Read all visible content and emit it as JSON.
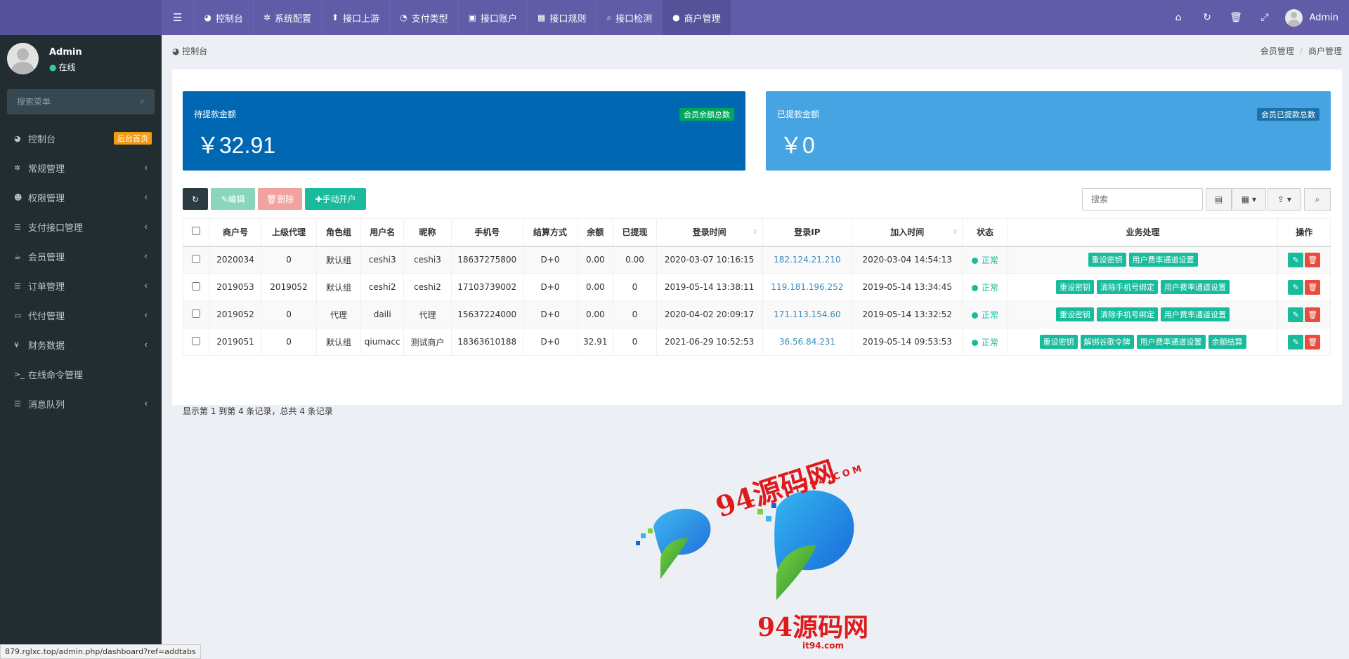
{
  "topnav": {
    "items": [
      {
        "icon": "dashboard-icon",
        "label": "控制台"
      },
      {
        "icon": "gear-icon",
        "label": "系统配置"
      },
      {
        "icon": "upload-icon",
        "label": "接口上游"
      },
      {
        "icon": "pie-icon",
        "label": "支付类型"
      },
      {
        "icon": "account-icon",
        "label": "接口账户"
      },
      {
        "icon": "rules-icon",
        "label": "接口规则"
      },
      {
        "icon": "search-icon",
        "label": "接口检测"
      },
      {
        "icon": "user-icon",
        "label": "商户管理"
      }
    ],
    "active": "商户管理",
    "right_icons": [
      "home-icon",
      "refresh-icon",
      "trash-icon",
      "fullscreen-icon"
    ],
    "user": "Admin"
  },
  "sidebar": {
    "username": "Admin",
    "status": "在线",
    "search_placeholder": "搜索菜单",
    "items": [
      {
        "label": "控制台",
        "badge": "后台首页",
        "icon": "dashboard-icon"
      },
      {
        "label": "常规管理",
        "icon": "cogs-icon"
      },
      {
        "label": "权限管理",
        "icon": "users-icon"
      },
      {
        "label": "支付接口管理",
        "icon": "list-icon"
      },
      {
        "label": "会员管理",
        "icon": "coffee-icon"
      },
      {
        "label": "订单管理",
        "icon": "list-icon"
      },
      {
        "label": "代付管理",
        "icon": "money-icon"
      },
      {
        "label": "财务数据",
        "icon": "yen-icon"
      },
      {
        "label": "在线命令管理",
        "icon": "terminal-icon"
      },
      {
        "label": "消息队列",
        "icon": "list-icon"
      }
    ]
  },
  "breadcrumb": {
    "home": "控制台",
    "path": [
      "会员管理",
      "商户管理"
    ]
  },
  "stats": [
    {
      "label": "待提款金额",
      "value": "￥32.91",
      "tag": "会员余额总数",
      "color": "#0068b3"
    },
    {
      "label": "已提款金额",
      "value": "￥0",
      "tag": "会员已提款总数",
      "color": "#45a4e1"
    }
  ],
  "toolbar": {
    "edit": "编辑",
    "delete": "删除",
    "add": "手动开户",
    "search_placeholder": "搜索"
  },
  "table": {
    "headers": [
      "商户号",
      "上级代理",
      "角色组",
      "用户名",
      "昵称",
      "手机号",
      "结算方式",
      "余额",
      "已提现",
      "登录时间",
      "登录IP",
      "加入时间",
      "状态",
      "业务处理",
      "操作"
    ],
    "rows": [
      {
        "id": "2020034",
        "parent": "0",
        "group": "默认组",
        "username": "ceshi3",
        "nickname": "ceshi3",
        "phone": "18637275800",
        "settle": "D+0",
        "balance": "0.00",
        "withdrawn": "0.00",
        "login_time": "2020-03-07 10:16:15",
        "login_ip": "182.124.21.210",
        "join_time": "2020-03-04 14:54:13",
        "status": "正常",
        "actions": [
          "重设密钥",
          "用户费率通道设置"
        ]
      },
      {
        "id": "2019053",
        "parent": "2019052",
        "group": "默认组",
        "username": "ceshi2",
        "nickname": "ceshi2",
        "phone": "17103739002",
        "settle": "D+0",
        "balance": "0.00",
        "withdrawn": "0",
        "login_time": "2019-05-14 13:38:11",
        "login_ip": "119.181.196.252",
        "join_time": "2019-05-14 13:34:45",
        "status": "正常",
        "actions": [
          "重设密钥",
          "清除手机号绑定",
          "用户费率通道设置"
        ]
      },
      {
        "id": "2019052",
        "parent": "0",
        "group": "代理",
        "username": "daili",
        "nickname": "代理",
        "phone": "15637224000",
        "settle": "D+0",
        "balance": "0.00",
        "withdrawn": "0",
        "login_time": "2020-04-02 20:09:17",
        "login_ip": "171.113.154.60",
        "join_time": "2019-05-14 13:32:52",
        "status": "正常",
        "actions": [
          "重设密钥",
          "清除手机号绑定",
          "用户费率通道设置"
        ]
      },
      {
        "id": "2019051",
        "parent": "0",
        "group": "默认组",
        "username": "qiumacc",
        "nickname": "测试商户",
        "phone": "18363610188",
        "settle": "D+0",
        "balance": "32.91",
        "withdrawn": "0",
        "login_time": "2021-06-29 10:52:53",
        "login_ip": "36.56.84.231",
        "join_time": "2019-05-14 09:53:53",
        "status": "正常",
        "actions": [
          "重设密钥",
          "解绑谷歌令牌",
          "用户费率通道设置",
          "余额结算"
        ]
      }
    ],
    "footer": "显示第 1 到第 4 条记录，总共 4 条记录"
  },
  "watermark": {
    "title": "94源码网",
    "domain_a": "IT94.COM",
    "title2": "94源码网",
    "domain_b": "it94.com"
  },
  "status_url": "879.rglxc.top/admin.php/dashboard?ref=addtabs"
}
